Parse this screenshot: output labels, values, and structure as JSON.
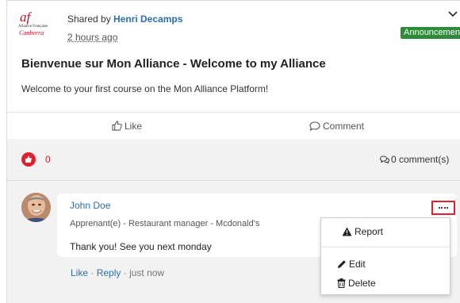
{
  "post": {
    "logo": {
      "mark": "af",
      "line1": "Alliance Française",
      "line2": "Canberra"
    },
    "shared_prefix": "Shared by",
    "author": "Henri Decamps",
    "time": "2 hours ago",
    "badge": "Announcement",
    "title": "Bienvenue sur Mon Alliance - Welcome to my Alliance",
    "body": "Welcome to your first course on the Mon Alliance Platform!"
  },
  "actions": {
    "like_label": "Like",
    "comment_label": "Comment"
  },
  "stats": {
    "reactions": "0",
    "comments": "0 comment(s)"
  },
  "comment": {
    "author": "John Doe",
    "role": "Apprenant(e) - Restaurant manager - Mcdonald's",
    "text": "Thank you! See you next monday",
    "like_label": "Like",
    "reply_label": "Reply",
    "time": "just now",
    "sep": "·"
  },
  "menu": {
    "report_label": "Report",
    "edit_label": "Edit",
    "delete_label": "Delete"
  },
  "colors": {
    "accent_blue": "#2a6fb0",
    "alert_red": "#e0202e",
    "badge_green": "#2e8b3a"
  },
  "icons": [
    "chevron-down-icon",
    "thumbs-up-icon",
    "speech-bubble-icon",
    "comments-icon",
    "warning-icon",
    "pencil-icon",
    "trash-icon",
    "more-dots-icon"
  ]
}
